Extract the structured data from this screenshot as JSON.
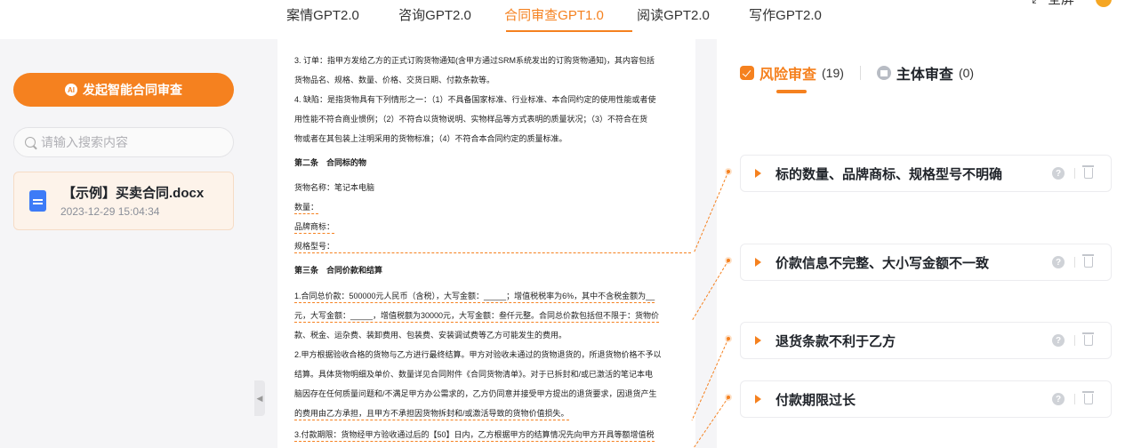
{
  "nav": {
    "tabs": [
      {
        "label": "案情GPT2.0"
      },
      {
        "label": "咨询GPT2.0"
      },
      {
        "label": "合同审查GPT1.0"
      },
      {
        "label": "阅读GPT2.0"
      },
      {
        "label": "写作GPT2.0"
      }
    ],
    "active_tab": "合同审查GPT1.0",
    "fullscreen_label": "全屏"
  },
  "sidebar": {
    "start_button_label": "发起智能合同审查",
    "ai_badge": "AI",
    "search_placeholder": "请输入搜索内容",
    "file": {
      "name": "【示例】买卖合同.docx",
      "time": "2023-12-29 15:04:34"
    }
  },
  "document": {
    "lines": [
      "3. 订单：指甲方发给乙方的正式订购货物通知(含甲方通过SRM系统发出的订购货物通知)，其内容包括",
      "货物品名、规格、数量、价格、交货日期、付款条款等。",
      "4. 缺陷：是指货物具有下列情形之一：（1）不具备国家标准、行业标准、本合同约定的使用性能或者使",
      "用性能不符合商业惯例；（2）不符合以货物说明、实物样品等方式表明的质量状况；（3）不符合在货",
      "物或者在其包装上注明采用的货物标准；（4）不符合本合同约定的质量标准。",
      "第二条　合同标的物",
      "货物名称：笔记本电脑",
      "数量：",
      "品牌商标：",
      "规格型号：",
      "第三条　合同价款和结算",
      "1.合同总价款：500000元人民币（含税），大写金额：_____；增值税税率为6%，其中不含税金额为__",
      "元，大写金额：_____，增值税额为30000元，大写金额：叁仟元整。合同总价款包括但不限于：货物价",
      "款、税金、运杂费、装卸费用、包装费、安装调试费等乙方可能发生的费用。",
      "2.甲方根据验收合格的货物与乙方进行最终结算。甲方对验收未通过的货物退货的，所退货物价格不予以",
      "结算。具体货物明细及单价、数量详见合同附件《合同货物清单》。对于已拆封和/或已激活的笔记本电",
      "脑因存在任何质量问题和/不满足甲方办公需求的，乙方仍同意并接受甲方提出的退货要求，因退货产生",
      "的费用由乙方承担，且甲方不承担因货物拆封和/或激活导致的货物价值损失。",
      "3.付款期限：货物经甲方验收通过后的【50】日内，乙方根据甲方的结算情况先向甲方开具等额增值税"
    ]
  },
  "review": {
    "tabs": [
      {
        "label": "风险审查",
        "count": "(19)"
      },
      {
        "label": "主体审查",
        "count": "(0)"
      }
    ],
    "risks": [
      {
        "title": "标的数量、品牌商标、规格型号不明确"
      },
      {
        "title": "价款信息不完整、大小写金额不一致"
      },
      {
        "title": "退货条款不利于乙方"
      },
      {
        "title": "付款期限过长"
      }
    ],
    "help_glyph": "?"
  },
  "colors": {
    "accent": "#f5811f",
    "doc_icon": "#3d7bf7"
  }
}
